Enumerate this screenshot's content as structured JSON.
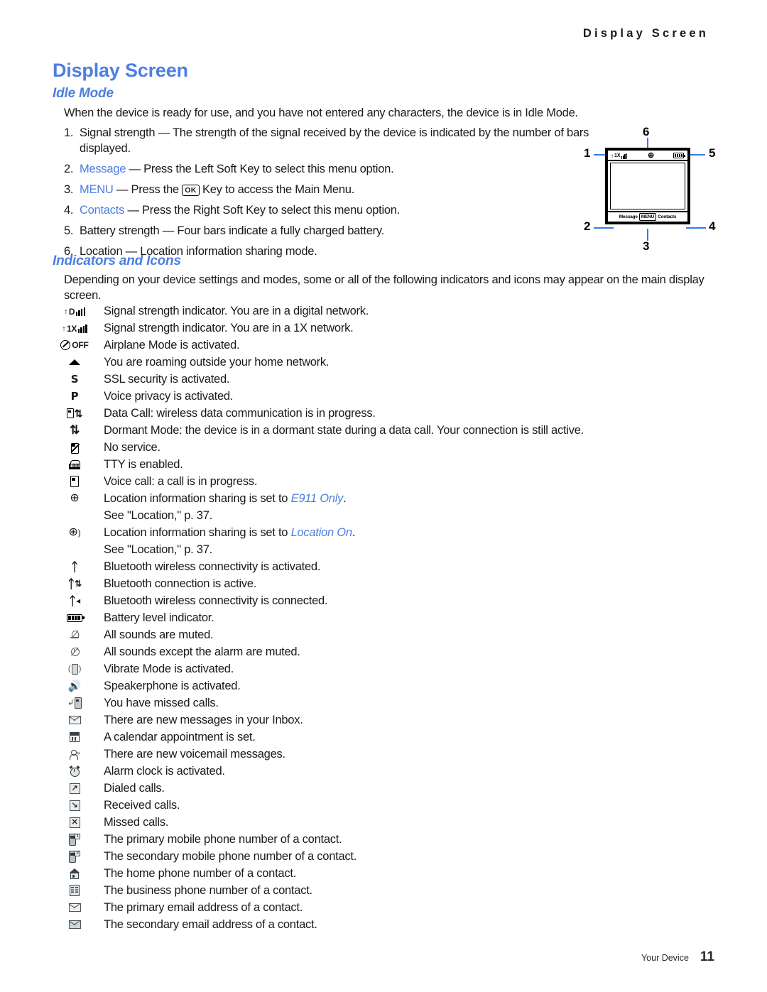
{
  "header": {
    "running_title": "Display Screen"
  },
  "title": "Display Screen",
  "sections": {
    "idle_mode": {
      "heading": "Idle Mode",
      "intro": "When the device is ready for use, and you have not entered any characters, the device is in Idle Mode.",
      "items": [
        {
          "num": "1.",
          "pre": "",
          "emphasis": "",
          "rest": "Signal strength — The strength of the signal received by the device is indicated by the number of bars displayed."
        },
        {
          "num": "2.",
          "pre": "",
          "emphasis": "Message",
          "rest": " — Press the Left Soft Key to select this menu option."
        },
        {
          "num": "3.",
          "pre": "",
          "emphasis": "MENU",
          "rest": " — Press the ",
          "key_label": "OK",
          "rest2": " Key to access the Main Menu."
        },
        {
          "num": "4.",
          "pre": "",
          "emphasis": "Contacts",
          "rest": " — Press the Right Soft Key to select this menu option."
        },
        {
          "num": "5.",
          "pre": "",
          "emphasis": "",
          "rest": "Battery strength — Four bars indicate a fully charged battery."
        },
        {
          "num": "6.",
          "pre": "",
          "emphasis": "",
          "rest": "Location — Location information sharing mode."
        }
      ]
    },
    "indicators": {
      "heading": "Indicators and Icons",
      "intro": "Depending on your device settings and modes, some or all of the following indicators and icons may appear on the main display screen."
    }
  },
  "diagram": {
    "callouts": {
      "one": "1",
      "two": "2",
      "three": "3",
      "four": "4",
      "five": "5",
      "six": "6"
    },
    "status_network": "1X",
    "left_soft_label": "Message",
    "center_key_label": "MENU",
    "right_soft_label": "Contacts"
  },
  "indicator_rows": [
    {
      "icon": "signal-digital-icon",
      "net": "D",
      "text": "Signal strength indicator. You are in a digital network."
    },
    {
      "icon": "signal-1x-icon",
      "net": "1X",
      "text": "Signal strength indicator. You are in a 1X network."
    },
    {
      "icon": "airplane-mode-icon",
      "net": "OFF",
      "text": "Airplane Mode is activated."
    },
    {
      "icon": "roaming-icon",
      "text": "You are roaming outside your home network."
    },
    {
      "icon": "ssl-security-icon",
      "glyph": "S",
      "text": "SSL security is activated."
    },
    {
      "icon": "voice-privacy-icon",
      "glyph": "P",
      "text": "Voice privacy is activated."
    },
    {
      "icon": "data-call-icon",
      "text": "Data Call: wireless data communication is in progress."
    },
    {
      "icon": "dormant-mode-icon",
      "text": "Dormant Mode: the device is in a dormant state during a data call. Your connection is still active."
    },
    {
      "icon": "no-service-icon",
      "text": "No service."
    },
    {
      "icon": "tty-icon",
      "text": "TTY is enabled."
    },
    {
      "icon": "voice-call-icon",
      "text": "Voice call: a call is in progress."
    },
    {
      "icon": "location-e911-icon",
      "text": "Location information sharing is set to ",
      "emphasis": "E911 Only",
      "after": ".",
      "text2": "See \"Location,\" p. 37."
    },
    {
      "icon": "location-on-icon",
      "text": "Location information sharing is set to ",
      "emphasis": "Location On",
      "after": ".",
      "text2": "See \"Location,\" p. 37."
    },
    {
      "icon": "bluetooth-icon",
      "text": "Bluetooth wireless connectivity is activated."
    },
    {
      "icon": "bluetooth-active-icon",
      "text": "Bluetooth connection is active."
    },
    {
      "icon": "bluetooth-connected-icon",
      "text": "Bluetooth wireless connectivity is connected."
    },
    {
      "icon": "battery-level-icon",
      "text": "Battery level indicator."
    },
    {
      "icon": "all-muted-icon",
      "text": "All sounds are muted."
    },
    {
      "icon": "muted-except-alarm-icon",
      "text": "All sounds except the alarm are muted."
    },
    {
      "icon": "vibrate-icon",
      "text": "Vibrate Mode is activated."
    },
    {
      "icon": "speakerphone-icon",
      "text": "Speakerphone is activated."
    },
    {
      "icon": "missed-calls-icon",
      "text": "You have missed calls."
    },
    {
      "icon": "inbox-message-icon",
      "text": "There are new messages in your Inbox."
    },
    {
      "icon": "calendar-icon",
      "text": "A calendar appointment is set."
    },
    {
      "icon": "voicemail-icon",
      "text": "There are new voicemail messages."
    },
    {
      "icon": "alarm-clock-icon",
      "text": "Alarm clock is activated."
    },
    {
      "icon": "dialed-calls-icon",
      "text": "Dialed calls."
    },
    {
      "icon": "received-calls-icon",
      "text": "Received calls."
    },
    {
      "icon": "missed-calls-log-icon",
      "text": "Missed calls."
    },
    {
      "icon": "primary-mobile-icon",
      "badge": "1",
      "text": "The primary mobile phone number of a contact."
    },
    {
      "icon": "secondary-mobile-icon",
      "badge": "2",
      "text": "The secondary mobile phone number of a contact."
    },
    {
      "icon": "home-phone-icon",
      "text": "The home phone number of a contact."
    },
    {
      "icon": "business-phone-icon",
      "text": "The business phone number of a contact."
    },
    {
      "icon": "primary-email-icon",
      "text": "The primary email address of a contact."
    },
    {
      "icon": "secondary-email-icon",
      "text": "The secondary email address of a contact."
    }
  ],
  "footer": {
    "section_label": "Your Device",
    "page_number": "11"
  },
  "colors": {
    "accent_blue": "#4d7fe0",
    "leader_blue": "#2f7fe8",
    "text": "#1a1a1a"
  }
}
